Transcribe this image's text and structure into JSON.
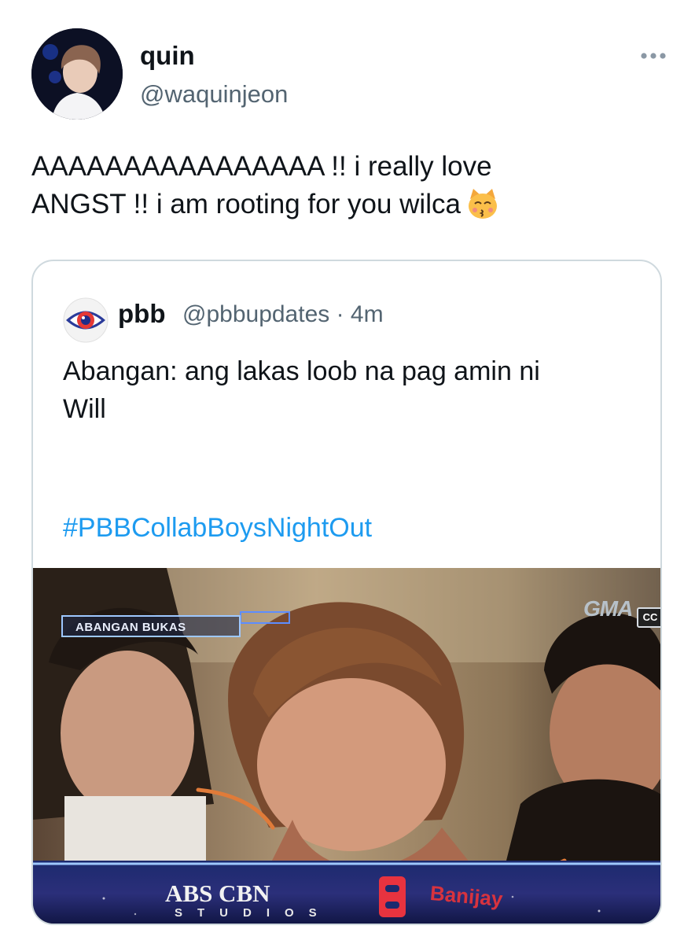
{
  "author": {
    "display_name": "quin",
    "handle": "@waquinjeon"
  },
  "tweet": {
    "lines": [
      "AAAAAAAAAAAAAAAA !! i really love",
      "ANGST !! i am rooting for you wilca"
    ],
    "emoji": "kissing-cat-face-icon"
  },
  "quoted_tweet": {
    "display_name": "pbb",
    "handle_time": "@pbbupdates · 4m",
    "lines": [
      "Abangan: ang lakas loob na pag amin ni",
      "Will"
    ],
    "hashtag": "#PBBCollabBoysNightOut",
    "media": {
      "overlay_label": "ABANGAN BUKAS",
      "network_logo": "GMA",
      "cc_badge": "CC",
      "studio_logo": "ABS CBN",
      "studio_subtitle": "STUDIOS",
      "partner_logo": "Banijay"
    }
  },
  "colors": {
    "link": "#1d9bf0",
    "secondary_text": "#536471",
    "border": "#cfd9de"
  }
}
